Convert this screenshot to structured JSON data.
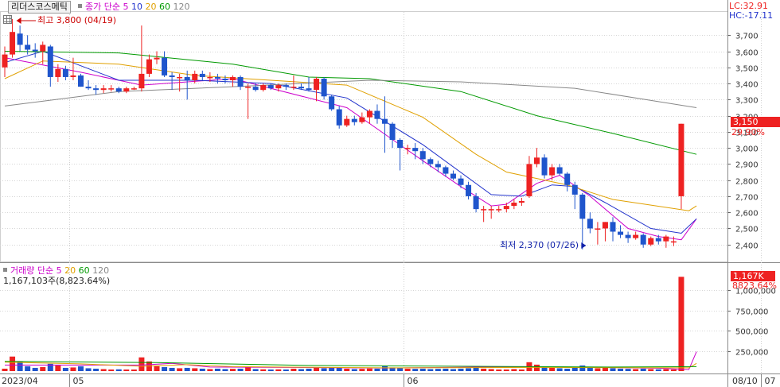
{
  "header": {
    "ticker": "리더스코스메틱",
    "indicator_name": "종가 단순",
    "ma_periods": [
      "5",
      "10",
      "20",
      "60",
      "120"
    ],
    "ma_colors": [
      "#cc00cc",
      "#2233cc",
      "#e0a000",
      "#009900",
      "#888888"
    ],
    "lc_text": "LC:32.91",
    "hc_text": "HC:-17.11"
  },
  "annotations": {
    "high_text": "최고 3,800 (04/19)",
    "low_text": "최저 2,370 (07/26)"
  },
  "last_price": {
    "value_text": "3,150",
    "change_text": "29.90%",
    "color": "#ee2222"
  },
  "volume_header": {
    "title": "거래량",
    "indicator_name": "단순",
    "ma_periods": [
      "5",
      "20",
      "60",
      "120"
    ],
    "value_text": "1,167,103주(8,823.64%)"
  },
  "volume_last": {
    "value_text": "1,167K",
    "change_text": "8823.64%"
  },
  "chart_data": {
    "type": "candlestick",
    "price_axis": {
      "min": 2300,
      "max": 3800,
      "ticks": [
        "3,700",
        "3,600",
        "3,500",
        "3,400",
        "3,300",
        "3,200",
        "3,100",
        "3,000",
        "2,900",
        "2,800",
        "2,700",
        "2,600",
        "2,500",
        "2,400"
      ]
    },
    "volume_axis": {
      "min": 0,
      "max": 1200000,
      "ticks": [
        "1,000,000",
        "750,000",
        "500,000",
        "250,000"
      ]
    },
    "x_labels": [
      "2023/04",
      "05",
      "06",
      "07",
      "08",
      "08/10"
    ],
    "month_starts": [
      0,
      9,
      53,
      100,
      145
    ],
    "up_color": "#ee2222",
    "down_color": "#1f55cc",
    "candles": [
      [
        3500,
        3630,
        3440,
        3580,
        30000
      ],
      [
        3580,
        3800,
        3560,
        3720,
        180000
      ],
      [
        3710,
        3760,
        3600,
        3640,
        120000
      ],
      [
        3640,
        3700,
        3580,
        3610,
        60000
      ],
      [
        3610,
        3650,
        3560,
        3600,
        40000
      ],
      [
        3600,
        3660,
        3520,
        3640,
        50000
      ],
      [
        3630,
        3640,
        3380,
        3440,
        90000
      ],
      [
        3440,
        3520,
        3410,
        3490,
        70000
      ],
      [
        3490,
        3510,
        3420,
        3440,
        40000
      ],
      [
        3440,
        3560,
        3420,
        3450,
        45000
      ],
      [
        3450,
        3460,
        3380,
        3380,
        60000
      ],
      [
        3380,
        3420,
        3360,
        3370,
        35000
      ],
      [
        3370,
        3390,
        3330,
        3360,
        30000
      ],
      [
        3360,
        3390,
        3340,
        3370,
        25000
      ],
      [
        3370,
        3390,
        3350,
        3370,
        20000
      ],
      [
        3370,
        3380,
        3340,
        3350,
        22000
      ],
      [
        3350,
        3380,
        3340,
        3370,
        20000
      ],
      [
        3370,
        3380,
        3360,
        3370,
        20000
      ],
      [
        3370,
        3760,
        3350,
        3460,
        170000
      ],
      [
        3460,
        3580,
        3440,
        3550,
        120000
      ],
      [
        3550,
        3600,
        3520,
        3560,
        60000
      ],
      [
        3560,
        3600,
        3440,
        3450,
        50000
      ],
      [
        3450,
        3470,
        3360,
        3440,
        40000
      ],
      [
        3440,
        3460,
        3350,
        3440,
        35000
      ],
      [
        3440,
        3480,
        3300,
        3420,
        40000
      ],
      [
        3420,
        3480,
        3400,
        3460,
        35000
      ],
      [
        3460,
        3480,
        3420,
        3440,
        30000
      ],
      [
        3440,
        3470,
        3410,
        3440,
        25000
      ],
      [
        3440,
        3460,
        3400,
        3430,
        30000
      ],
      [
        3430,
        3450,
        3400,
        3420,
        25000
      ],
      [
        3420,
        3450,
        3380,
        3440,
        28000
      ],
      [
        3440,
        3450,
        3360,
        3380,
        30000
      ],
      [
        3380,
        3400,
        3180,
        3380,
        50000
      ],
      [
        3380,
        3400,
        3350,
        3360,
        25000
      ],
      [
        3360,
        3400,
        3350,
        3390,
        22000
      ],
      [
        3390,
        3400,
        3360,
        3370,
        20000
      ],
      [
        3370,
        3400,
        3350,
        3390,
        22000
      ],
      [
        3390,
        3400,
        3360,
        3380,
        20000
      ],
      [
        3380,
        3450,
        3360,
        3380,
        30000
      ],
      [
        3380,
        3400,
        3360,
        3370,
        25000
      ],
      [
        3370,
        3440,
        3350,
        3360,
        30000
      ],
      [
        3360,
        3440,
        3290,
        3430,
        40000
      ],
      [
        3430,
        3440,
        3300,
        3320,
        35000
      ],
      [
        3320,
        3330,
        3230,
        3240,
        40000
      ],
      [
        3240,
        3260,
        3120,
        3140,
        45000
      ],
      [
        3140,
        3200,
        3130,
        3180,
        30000
      ],
      [
        3180,
        3200,
        3140,
        3160,
        25000
      ],
      [
        3160,
        3220,
        3150,
        3190,
        28000
      ],
      [
        3190,
        3240,
        3150,
        3230,
        32000
      ],
      [
        3230,
        3270,
        3150,
        3180,
        30000
      ],
      [
        3180,
        3320,
        2970,
        3150,
        60000
      ],
      [
        3150,
        3160,
        3000,
        3050,
        45000
      ],
      [
        3050,
        3060,
        2860,
        3000,
        40000
      ],
      [
        3000,
        3020,
        2960,
        3000,
        30000
      ],
      [
        3000,
        3030,
        2930,
        2980,
        28000
      ],
      [
        2980,
        3000,
        2900,
        2930,
        30000
      ],
      [
        2930,
        2940,
        2880,
        2900,
        25000
      ],
      [
        2900,
        2920,
        2850,
        2880,
        28000
      ],
      [
        2880,
        2890,
        2820,
        2840,
        30000
      ],
      [
        2840,
        2860,
        2800,
        2810,
        25000
      ],
      [
        2810,
        2830,
        2750,
        2770,
        30000
      ],
      [
        2770,
        2790,
        2680,
        2700,
        35000
      ],
      [
        2700,
        2720,
        2600,
        2620,
        40000
      ],
      [
        2620,
        2640,
        2540,
        2620,
        30000
      ],
      [
        2620,
        2640,
        2560,
        2620,
        25000
      ],
      [
        2620,
        2640,
        2600,
        2620,
        20000
      ],
      [
        2620,
        2660,
        2600,
        2640,
        20000
      ],
      [
        2640,
        2680,
        2620,
        2660,
        25000
      ],
      [
        2660,
        2690,
        2640,
        2670,
        20000
      ],
      [
        2700,
        2950,
        2690,
        2900,
        110000
      ],
      [
        2900,
        3000,
        2880,
        2940,
        80000
      ],
      [
        2940,
        2960,
        2810,
        2830,
        50000
      ],
      [
        2830,
        2900,
        2800,
        2880,
        40000
      ],
      [
        2880,
        2900,
        2830,
        2840,
        35000
      ],
      [
        2840,
        2850,
        2730,
        2770,
        30000
      ],
      [
        2770,
        2790,
        2620,
        2710,
        40000
      ],
      [
        2710,
        2720,
        2370,
        2560,
        70000
      ],
      [
        2560,
        2600,
        2470,
        2500,
        50000
      ],
      [
        2500,
        2540,
        2400,
        2500,
        35000
      ],
      [
        2500,
        2540,
        2420,
        2540,
        40000
      ],
      [
        2540,
        2570,
        2420,
        2480,
        35000
      ],
      [
        2480,
        2520,
        2440,
        2460,
        30000
      ],
      [
        2460,
        2480,
        2410,
        2440,
        28000
      ],
      [
        2440,
        2480,
        2430,
        2460,
        25000
      ],
      [
        2460,
        2470,
        2380,
        2400,
        30000
      ],
      [
        2400,
        2450,
        2390,
        2440,
        25000
      ],
      [
        2440,
        2460,
        2400,
        2420,
        22000
      ],
      [
        2420,
        2460,
        2380,
        2450,
        25000
      ],
      [
        2420,
        2450,
        2390,
        2420,
        20000
      ],
      [
        2700,
        3150,
        2620,
        3150,
        1167103
      ]
    ],
    "ma": {
      "5": [
        [
          0,
          3560
        ],
        [
          10,
          3470
        ],
        [
          18,
          3390
        ],
        [
          30,
          3430
        ],
        [
          45,
          3250
        ],
        [
          55,
          2920
        ],
        [
          60,
          2760
        ],
        [
          64,
          2640
        ],
        [
          66,
          2650
        ],
        [
          70,
          2780
        ],
        [
          73,
          2830
        ],
        [
          77,
          2700
        ],
        [
          82,
          2500
        ],
        [
          86,
          2450
        ],
        [
          89,
          2430
        ],
        [
          91,
          2560
        ]
      ],
      "10": [
        [
          0,
          3530
        ],
        [
          5,
          3600
        ],
        [
          15,
          3420
        ],
        [
          25,
          3420
        ],
        [
          35,
          3400
        ],
        [
          45,
          3310
        ],
        [
          55,
          3020
        ],
        [
          64,
          2710
        ],
        [
          68,
          2700
        ],
        [
          72,
          2770
        ],
        [
          75,
          2760
        ],
        [
          79,
          2660
        ],
        [
          85,
          2500
        ],
        [
          89,
          2470
        ],
        [
          91,
          2560
        ]
      ],
      "20": [
        [
          0,
          3430
        ],
        [
          5,
          3540
        ],
        [
          15,
          3520
        ],
        [
          25,
          3450
        ],
        [
          35,
          3420
        ],
        [
          45,
          3390
        ],
        [
          55,
          3190
        ],
        [
          62,
          2960
        ],
        [
          66,
          2850
        ],
        [
          74,
          2770
        ],
        [
          80,
          2680
        ],
        [
          90,
          2610
        ],
        [
          91,
          2640
        ]
      ],
      "60": [
        [
          0,
          3600
        ],
        [
          15,
          3590
        ],
        [
          30,
          3520
        ],
        [
          40,
          3440
        ],
        [
          48,
          3430
        ],
        [
          60,
          3350
        ],
        [
          70,
          3200
        ],
        [
          80,
          3090
        ],
        [
          91,
          2960
        ]
      ],
      "120": [
        [
          0,
          3260
        ],
        [
          15,
          3350
        ],
        [
          30,
          3380
        ],
        [
          48,
          3420
        ],
        [
          60,
          3410
        ],
        [
          75,
          3370
        ],
        [
          91,
          3250
        ]
      ]
    },
    "volume_ma": {
      "5": [
        [
          0,
          75000
        ],
        [
          18,
          75000
        ],
        [
          22,
          95000
        ],
        [
          27,
          50000
        ],
        [
          50,
          38000
        ],
        [
          69,
          55000
        ],
        [
          76,
          48000
        ],
        [
          86,
          35000
        ],
        [
          90,
          20000
        ],
        [
          91,
          240000
        ]
      ],
      "20": [
        [
          0,
          110000
        ],
        [
          10,
          90000
        ],
        [
          18,
          60000
        ],
        [
          24,
          80000
        ],
        [
          30,
          55000
        ],
        [
          50,
          40000
        ],
        [
          70,
          45000
        ],
        [
          90,
          40000
        ],
        [
          91,
          95000
        ]
      ],
      "60": [
        [
          0,
          120000
        ],
        [
          20,
          105000
        ],
        [
          40,
          70000
        ],
        [
          60,
          60000
        ],
        [
          80,
          50000
        ],
        [
          91,
          55000
        ]
      ]
    }
  }
}
